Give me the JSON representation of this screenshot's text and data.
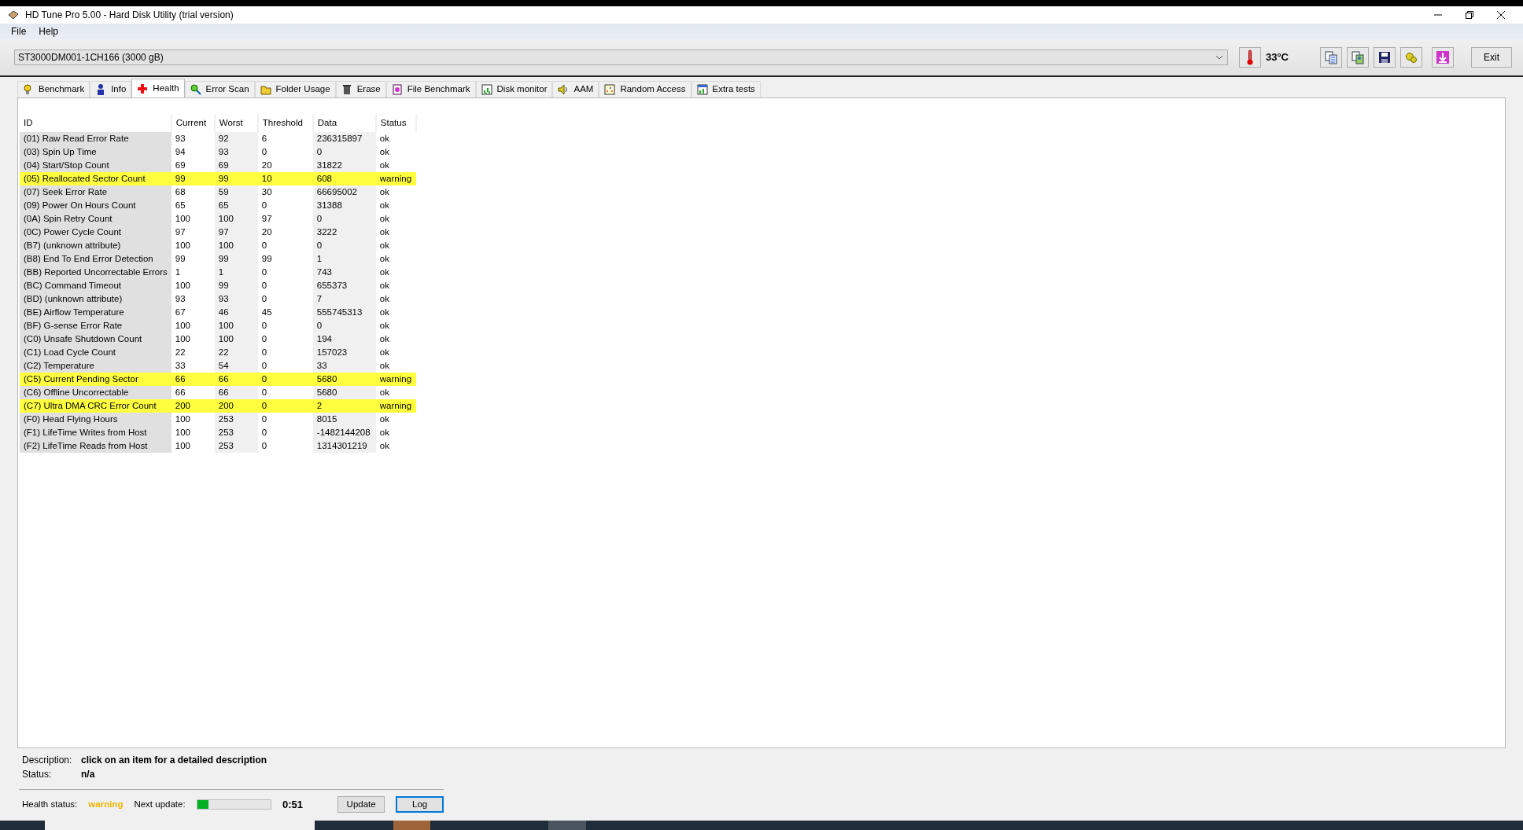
{
  "window": {
    "title": "HD Tune Pro 5.00 - Hard Disk Utility (trial version)"
  },
  "menu": [
    "File",
    "Help"
  ],
  "drive": {
    "value": "ST3000DM001-1CH166 (3000 gB)"
  },
  "temperature": "33°C",
  "exit_button": "Exit",
  "tabs": [
    {
      "label": "Benchmark",
      "selected": false
    },
    {
      "label": "Info",
      "selected": false
    },
    {
      "label": "Health",
      "selected": true
    },
    {
      "label": "Error Scan",
      "selected": false
    },
    {
      "label": "Folder Usage",
      "selected": false
    },
    {
      "label": "Erase",
      "selected": false
    },
    {
      "label": "File Benchmark",
      "selected": false
    },
    {
      "label": "Disk monitor",
      "selected": false
    },
    {
      "label": "AAM",
      "selected": false
    },
    {
      "label": "Random Access",
      "selected": false
    },
    {
      "label": "Extra tests",
      "selected": false
    }
  ],
  "table": {
    "columns": [
      "ID",
      "Current",
      "Worst",
      "Threshold",
      "Data",
      "Status"
    ],
    "rows": [
      {
        "cells": [
          "(01) Raw Read Error Rate",
          "93",
          "92",
          "6",
          "236315897",
          "ok"
        ],
        "highlighted": false
      },
      {
        "cells": [
          "(03) Spin Up Time",
          "94",
          "93",
          "0",
          "0",
          "ok"
        ],
        "highlighted": false
      },
      {
        "cells": [
          "(04) Start/Stop Count",
          "69",
          "69",
          "20",
          "31822",
          "ok"
        ],
        "highlighted": false
      },
      {
        "cells": [
          "(05) Reallocated Sector Count",
          "99",
          "99",
          "10",
          "608",
          "warning"
        ],
        "highlighted": true
      },
      {
        "cells": [
          "(07) Seek Error Rate",
          "68",
          "59",
          "30",
          "66695002",
          "ok"
        ],
        "highlighted": false
      },
      {
        "cells": [
          "(09) Power On Hours Count",
          "65",
          "65",
          "0",
          "31388",
          "ok"
        ],
        "highlighted": false
      },
      {
        "cells": [
          "(0A) Spin Retry Count",
          "100",
          "100",
          "97",
          "0",
          "ok"
        ],
        "highlighted": false
      },
      {
        "cells": [
          "(0C) Power Cycle Count",
          "97",
          "97",
          "20",
          "3222",
          "ok"
        ],
        "highlighted": false
      },
      {
        "cells": [
          "(B7) (unknown attribute)",
          "100",
          "100",
          "0",
          "0",
          "ok"
        ],
        "highlighted": false
      },
      {
        "cells": [
          "(B8) End To End Error Detection",
          "99",
          "99",
          "99",
          "1",
          "ok"
        ],
        "highlighted": false
      },
      {
        "cells": [
          "(BB) Reported Uncorrectable Errors",
          "1",
          "1",
          "0",
          "743",
          "ok"
        ],
        "highlighted": false
      },
      {
        "cells": [
          "(BC) Command Timeout",
          "100",
          "99",
          "0",
          "655373",
          "ok"
        ],
        "highlighted": false
      },
      {
        "cells": [
          "(BD) (unknown attribute)",
          "93",
          "93",
          "0",
          "7",
          "ok"
        ],
        "highlighted": false
      },
      {
        "cells": [
          "(BE) Airflow Temperature",
          "67",
          "46",
          "45",
          "555745313",
          "ok"
        ],
        "highlighted": false
      },
      {
        "cells": [
          "(BF) G-sense Error Rate",
          "100",
          "100",
          "0",
          "0",
          "ok"
        ],
        "highlighted": false
      },
      {
        "cells": [
          "(C0) Unsafe Shutdown Count",
          "100",
          "100",
          "0",
          "194",
          "ok"
        ],
        "highlighted": false
      },
      {
        "cells": [
          "(C1) Load Cycle Count",
          "22",
          "22",
          "0",
          "157023",
          "ok"
        ],
        "highlighted": false
      },
      {
        "cells": [
          "(C2) Temperature",
          "33",
          "54",
          "0",
          "33",
          "ok"
        ],
        "highlighted": false
      },
      {
        "cells": [
          "(C5) Current Pending Sector",
          "66",
          "66",
          "0",
          "5680",
          "warning"
        ],
        "highlighted": true
      },
      {
        "cells": [
          "(C6) Offline Uncorrectable",
          "66",
          "66",
          "0",
          "5680",
          "ok"
        ],
        "highlighted": false
      },
      {
        "cells": [
          "(C7) Ultra DMA CRC Error Count",
          "200",
          "200",
          "0",
          "2",
          "warning"
        ],
        "highlighted": true
      },
      {
        "cells": [
          "(F0) Head Flying Hours",
          "100",
          "253",
          "0",
          "8015",
          "ok"
        ],
        "highlighted": false
      },
      {
        "cells": [
          "(F1) LifeTime Writes from Host",
          "100",
          "253",
          "0",
          "-1482144208",
          "ok"
        ],
        "highlighted": false
      },
      {
        "cells": [
          "(F2) LifeTime Reads from Host",
          "100",
          "253",
          "0",
          "1314301219",
          "ok"
        ],
        "highlighted": false
      }
    ]
  },
  "details": {
    "description_label": "Description:",
    "description": "click on an item for a detailed description",
    "status_label": "Status:",
    "status": "n/a"
  },
  "footer": {
    "health_label": "Health status:",
    "health": "warning",
    "next_update_label": "Next update:",
    "level": 0.15,
    "countdown": "0:51",
    "buttons": [
      {
        "label": "Update",
        "focused": false
      },
      {
        "label": "Log",
        "focused": true
      }
    ]
  }
}
